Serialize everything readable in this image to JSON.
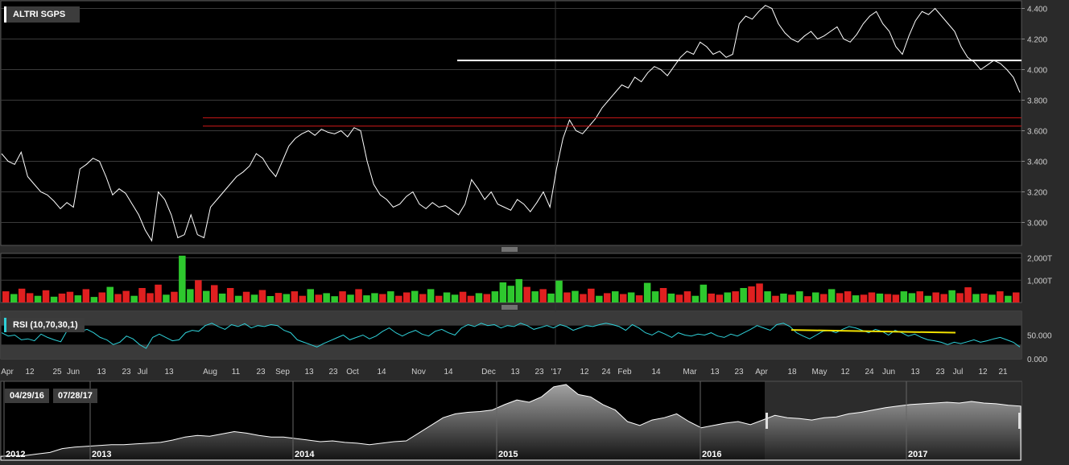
{
  "legend": {
    "main": "ALTRI SGPS",
    "rsi": "RSI (10,70,30,1)"
  },
  "range": {
    "start": "04/29/16",
    "end": "07/28/17"
  },
  "colors": {
    "price": "#ffffff",
    "resistance": "#ffffff",
    "support": "#d01818",
    "vol_up": "#2ec82e",
    "vol_down": "#e02020",
    "rsi": "#2fd0d8",
    "rsi_trend": "#f0e000",
    "grid": "#3a3a3a"
  },
  "chart_data": [
    {
      "type": "line",
      "title": "ALTRI SGPS",
      "xlabel": "",
      "ylabel": "",
      "ylim": [
        2.85,
        4.45
      ],
      "yticks": [
        "4.400",
        "4.200",
        "4.000",
        "3.800",
        "3.600",
        "3.400",
        "3.200",
        "3.000"
      ],
      "yticks_values": [
        4.4,
        4.2,
        4.0,
        3.8,
        3.6,
        3.4,
        3.2,
        3.0
      ],
      "series": [
        {
          "values": [
            3.45,
            3.4,
            3.38,
            3.46,
            3.3,
            3.25,
            3.2,
            3.18,
            3.14,
            3.09,
            3.13,
            3.1,
            3.35,
            3.38,
            3.42,
            3.4,
            3.3,
            3.18,
            3.22,
            3.19,
            3.12,
            3.05,
            2.95,
            2.88,
            3.2,
            3.15,
            3.05,
            2.9,
            2.92,
            3.05,
            2.92,
            2.9,
            3.1,
            3.15,
            3.2,
            3.25,
            3.3,
            3.33,
            3.37,
            3.45,
            3.42,
            3.35,
            3.3,
            3.4,
            3.5,
            3.55,
            3.58,
            3.6,
            3.57,
            3.61,
            3.59,
            3.58,
            3.6,
            3.56,
            3.62,
            3.6,
            3.4,
            3.25,
            3.18,
            3.15,
            3.1,
            3.12,
            3.17,
            3.2,
            3.12,
            3.09,
            3.13,
            3.1,
            3.11,
            3.08,
            3.05,
            3.12,
            3.28,
            3.22,
            3.15,
            3.2,
            3.12,
            3.1,
            3.08,
            3.15,
            3.12,
            3.07,
            3.13,
            3.2,
            3.1,
            3.35,
            3.55,
            3.67,
            3.6,
            3.58,
            3.63,
            3.68,
            3.75,
            3.8,
            3.85,
            3.9,
            3.88,
            3.95,
            3.92,
            3.98,
            4.02,
            4.0,
            3.96,
            4.02,
            4.08,
            4.12,
            4.1,
            4.18,
            4.15,
            4.1,
            4.12,
            4.08,
            4.1,
            4.3,
            4.35,
            4.33,
            4.38,
            4.42,
            4.4,
            4.3,
            4.24,
            4.2,
            4.18,
            4.22,
            4.25,
            4.2,
            4.22,
            4.25,
            4.28,
            4.2,
            4.18,
            4.23,
            4.3,
            4.35,
            4.38,
            4.3,
            4.25,
            4.15,
            4.1,
            4.22,
            4.32,
            4.38,
            4.36,
            4.4,
            4.35,
            4.3,
            4.25,
            4.15,
            4.08,
            4.05,
            4.0,
            4.03,
            4.06,
            4.04,
            4.0,
            3.95,
            3.85
          ]
        }
      ],
      "hlines": [
        {
          "y": 4.06,
          "color": "resistance"
        },
        {
          "y": 3.685,
          "color": "support"
        },
        {
          "y": 3.63,
          "color": "support"
        }
      ]
    },
    {
      "type": "bar",
      "title": "",
      "ylim": [
        0,
        2200
      ],
      "yticks": [
        "2,000T",
        "1,000T"
      ],
      "yticks_values": [
        2000,
        1000
      ],
      "values": [
        500,
        380,
        620,
        420,
        300,
        550,
        260,
        400,
        480,
        320,
        600,
        250,
        450,
        700,
        380,
        520,
        300,
        650,
        420,
        800,
        350,
        480,
        2100,
        600,
        1000,
        520,
        780,
        400,
        650,
        300,
        480,
        350,
        560,
        290,
        430,
        380,
        500,
        300,
        600,
        350,
        420,
        280,
        500,
        350,
        600,
        320,
        420,
        380,
        500,
        300,
        450,
        520,
        380,
        600,
        300,
        450,
        350,
        480,
        300,
        420,
        380,
        500,
        900,
        750,
        1050,
        700,
        500,
        600,
        400,
        980,
        450,
        520,
        380,
        620,
        300,
        420,
        500,
        380,
        450,
        320,
        880,
        500,
        650,
        400,
        350,
        500,
        300,
        800,
        400,
        350,
        450,
        500,
        650,
        720,
        850,
        500,
        300,
        400,
        350,
        500,
        280,
        450,
        380,
        600,
        420,
        500,
        320,
        350,
        450,
        400,
        380,
        350,
        500,
        420,
        500,
        300,
        450,
        380,
        550,
        420,
        680,
        380,
        400,
        350,
        500,
        300,
        450
      ],
      "up": [
        0,
        1,
        0,
        0,
        1,
        0,
        1,
        0,
        0,
        1,
        0,
        1,
        0,
        1,
        0,
        0,
        1,
        0,
        0,
        0,
        1,
        0,
        1,
        1,
        0,
        1,
        0,
        1,
        0,
        1,
        0,
        1,
        0,
        1,
        0,
        1,
        0,
        0,
        1,
        0,
        1,
        1,
        0,
        1,
        0,
        1,
        1,
        0,
        1,
        0,
        0,
        1,
        0,
        1,
        0,
        1,
        1,
        0,
        0,
        1,
        0,
        1,
        1,
        1,
        1,
        0,
        1,
        0,
        1,
        1,
        0,
        1,
        0,
        0,
        1,
        0,
        1,
        0,
        1,
        0,
        1,
        1,
        0,
        1,
        0,
        0,
        1,
        1,
        0,
        0,
        1,
        0,
        1,
        0,
        0,
        1,
        0,
        1,
        0,
        1,
        0,
        1,
        0,
        1,
        0,
        0,
        1,
        0,
        0,
        1,
        0,
        0,
        1,
        1,
        0,
        1,
        0,
        0,
        1,
        0,
        0,
        1,
        0,
        1,
        0,
        1,
        0
      ]
    },
    {
      "type": "line",
      "title": "RSI (10,70,30,1)",
      "ylim": [
        0,
        100
      ],
      "yticks": [
        "50.000",
        "0.000"
      ],
      "yticks_values": [
        50,
        0
      ],
      "bands": [
        30,
        70
      ],
      "series": [
        {
          "values": [
            55,
            48,
            50,
            40,
            42,
            38,
            52,
            45,
            40,
            36,
            60,
            64,
            58,
            62,
            55,
            45,
            40,
            30,
            35,
            48,
            42,
            30,
            22,
            45,
            52,
            45,
            38,
            40,
            55,
            60,
            58,
            70,
            75,
            68,
            62,
            72,
            68,
            74,
            65,
            70,
            68,
            72,
            70,
            60,
            55,
            40,
            35,
            30,
            25,
            32,
            38,
            44,
            50,
            40,
            45,
            50,
            42,
            48,
            58,
            65,
            55,
            48,
            55,
            60,
            52,
            48,
            58,
            62,
            55,
            50,
            65,
            72,
            68,
            75,
            70,
            72,
            65,
            70,
            68,
            75,
            70,
            62,
            66,
            70,
            65,
            72,
            68,
            60,
            65,
            70,
            68,
            72,
            75,
            72,
            68,
            60,
            72,
            65,
            55,
            50,
            58,
            52,
            45,
            55,
            50,
            48,
            52,
            50,
            55,
            48,
            45,
            52,
            48,
            55,
            62,
            70,
            65,
            60,
            72,
            75,
            68,
            55,
            48,
            42,
            50,
            58,
            60,
            55,
            62,
            68,
            65,
            60,
            55,
            62,
            58,
            50,
            60,
            55,
            48,
            52,
            45,
            40,
            38,
            35,
            30,
            35,
            32,
            36,
            40,
            35,
            38,
            42,
            45,
            40,
            35,
            25
          ]
        }
      ],
      "trendline": {
        "from": 60.8,
        "to": 55
      }
    }
  ],
  "xaxis": {
    "labels": [
      "Apr",
      "12",
      "25",
      "Jun",
      "13",
      "23",
      "Jul",
      "13",
      "Aug",
      "11",
      "23",
      "Sep",
      "13",
      "23",
      "Oct",
      "14",
      "Nov",
      "14",
      "Dec",
      "13",
      "23",
      "'17",
      "12",
      "24",
      "Feb",
      "14",
      "Mar",
      "13",
      "23",
      "Apr",
      "18",
      "May",
      "12",
      "24",
      "Jun",
      "13",
      "23",
      "Jul",
      "12",
      "21"
    ],
    "label_x": [
      9,
      37,
      71,
      91,
      126,
      157,
      177,
      210,
      261,
      293,
      324,
      351,
      384,
      414,
      438,
      474,
      520,
      557,
      607,
      640,
      670,
      691,
      726,
      753,
      776,
      815,
      857,
      888,
      918,
      946,
      984,
      1018,
      1050,
      1080,
      1104,
      1137,
      1168,
      1190,
      1221,
      1246
    ]
  },
  "overview": {
    "years": [
      "2012",
      "2013",
      "2014",
      "2015",
      "2016",
      "2017"
    ],
    "values": [
      0.05,
      0.06,
      0.06,
      0.08,
      0.1,
      0.15,
      0.17,
      0.18,
      0.19,
      0.2,
      0.2,
      0.21,
      0.22,
      0.23,
      0.26,
      0.3,
      0.32,
      0.31,
      0.34,
      0.37,
      0.35,
      0.32,
      0.3,
      0.3,
      0.28,
      0.26,
      0.24,
      0.25,
      0.23,
      0.22,
      0.2,
      0.22,
      0.24,
      0.25,
      0.35,
      0.45,
      0.55,
      0.6,
      0.62,
      0.63,
      0.65,
      0.72,
      0.78,
      0.75,
      0.82,
      0.95,
      0.98,
      0.85,
      0.82,
      0.72,
      0.65,
      0.5,
      0.45,
      0.52,
      0.55,
      0.6,
      0.5,
      0.42,
      0.45,
      0.48,
      0.5,
      0.46,
      0.52,
      0.58,
      0.55,
      0.54,
      0.52,
      0.55,
      0.56,
      0.6,
      0.62,
      0.65,
      0.68,
      0.7,
      0.72,
      0.73,
      0.74,
      0.75,
      0.74,
      0.76,
      0.74,
      0.73,
      0.71,
      0.7
    ]
  }
}
